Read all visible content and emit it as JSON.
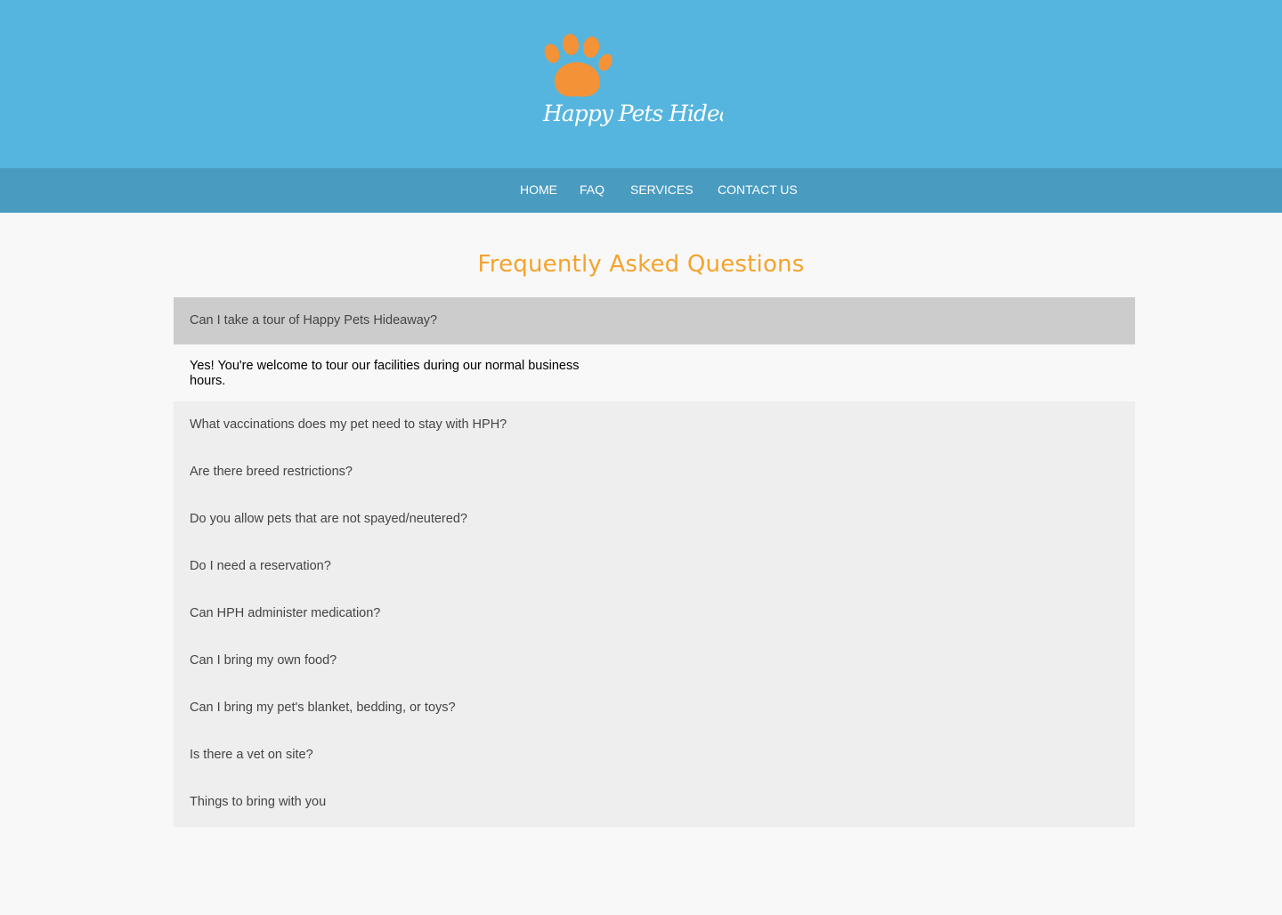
{
  "header": {
    "logo_text": "Happy Pets Hideaway",
    "colors": {
      "header_bg": "#56b5de",
      "nav_bg": "#4a9bc0",
      "paw": "#f39237",
      "title": "#f4a32e"
    }
  },
  "nav": {
    "items": [
      {
        "label": "HOME"
      },
      {
        "label": "FAQ"
      },
      {
        "label": "SERVICES"
      },
      {
        "label": "CONTACT US"
      }
    ]
  },
  "main": {
    "title": "Frequently Asked Questions",
    "active_question": "Can I take a tour of Happy Pets Hideaway?",
    "active_answer": "Yes! You're welcome to tour our facilities during our normal business hours.",
    "questions": [
      "What vaccinations does my pet need to stay with HPH?",
      "Are there breed restrictions?",
      "Do you allow pets that are not spayed/neutered?",
      "Do I need a reservation?",
      "Can HPH administer medication?",
      "Can I bring my own food?",
      "Can I bring my pet's blanket, bedding, or toys?",
      "Is there a vet on site?",
      "Things to bring with you"
    ]
  }
}
